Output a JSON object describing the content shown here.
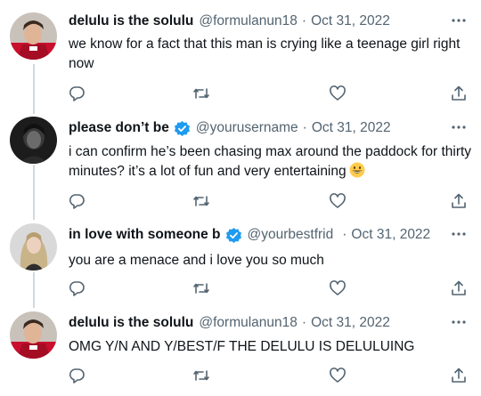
{
  "tweets": [
    {
      "display_name": "delulu is the solulu",
      "handle": "@formulanun18",
      "separator": "·",
      "date": "Oct 31, 2022",
      "verified": false,
      "text": "we know for a fact that this man is crying like a teenage girl right now"
    },
    {
      "display_name": "please don’t be",
      "handle": "@yourusername",
      "separator": "·",
      "date": "Oct 31, 2022",
      "verified": true,
      "text": "i can confirm he’s been chasing max around the paddock for thirty minutes? it’s a lot of fun and very entertaining"
    },
    {
      "display_name": "in love with someone b",
      "handle": "@yourbestfrid",
      "separator": "·",
      "date": "Oct 31, 2022",
      "verified": true,
      "text": "you are a menace and i love you so much"
    },
    {
      "display_name": "delulu is the solulu",
      "handle": "@formulanun18",
      "separator": "·",
      "date": "Oct 31, 2022",
      "verified": false,
      "text": "OMG Y/N AND Y/BEST/F THE DELULU IS DELULUING"
    }
  ],
  "icons": {
    "reply": "reply-icon",
    "retweet": "retweet-icon",
    "like": "like-icon",
    "share": "share-icon",
    "more": "more-icon",
    "verified": "verified-badge-icon",
    "emoji": "grinning-face-emoji"
  },
  "colors": {
    "text": "#0f1419",
    "secondary": "#536471",
    "verified": "#1d9bf0",
    "thread_line": "#cfd9de"
  }
}
